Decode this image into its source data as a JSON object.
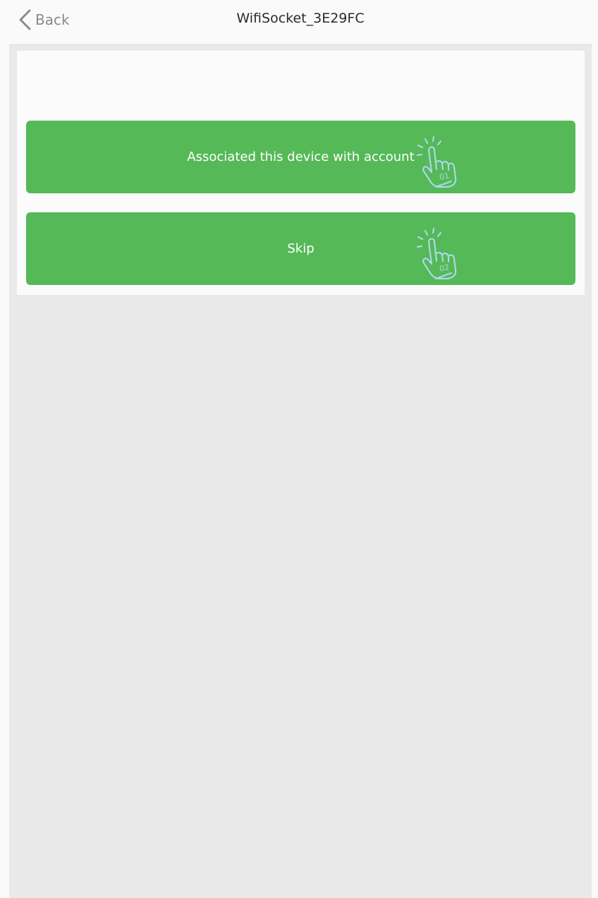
{
  "header": {
    "back_label": "Back",
    "title": "WifiSocket_3E29FC"
  },
  "actions": [
    {
      "label": "Associated this device with account",
      "icon": "tap-hand-01-icon",
      "step": "01"
    },
    {
      "label": "Skip",
      "icon": "tap-hand-02-icon",
      "step": "02"
    }
  ],
  "colors": {
    "button": "#55b957",
    "background": "#e9e9e9",
    "icon": "#a9d8e6"
  }
}
